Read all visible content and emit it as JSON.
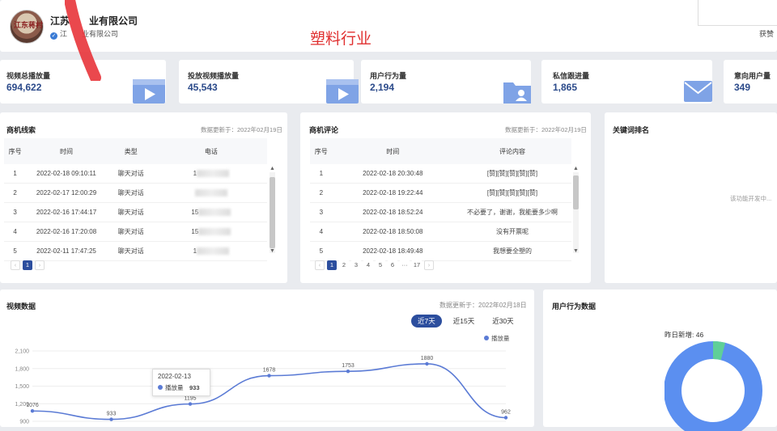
{
  "header": {
    "avatar_text": "江东蒋村",
    "company_name": "江苏　　业有限公司",
    "verified_text": "江　　业有限公司",
    "overlay_title": "塑料行业",
    "right_text": "获赞"
  },
  "stats": [
    {
      "label": "视频总播放量",
      "value": "694,622",
      "icon": "video-icon"
    },
    {
      "label": "投放视频播放量",
      "value": "45,543",
      "icon": "video-icon"
    },
    {
      "label": "用户行为量",
      "value": "2,194",
      "icon": "folder-user-icon"
    },
    {
      "label": "私信跟进量",
      "value": "1,865",
      "icon": "mail-icon"
    },
    {
      "label": "意向用户量",
      "value": "349",
      "icon": "user-icon"
    }
  ],
  "leads": {
    "title": "商机线索",
    "updated": "数据更新于：2022年02月19日",
    "columns": [
      "序号",
      "时间",
      "类型",
      "电话"
    ],
    "rows": [
      {
        "no": "1",
        "time": "2022-02-18 09:10:11",
        "type": "聊天对话",
        "phone": "1"
      },
      {
        "no": "2",
        "time": "2022-02-17 12:00:29",
        "type": "聊天对话",
        "phone": ""
      },
      {
        "no": "3",
        "time": "2022-02-16 17:44:17",
        "type": "聊天对话",
        "phone": "15"
      },
      {
        "no": "4",
        "time": "2022-02-16 17:20:08",
        "type": "聊天对话",
        "phone": "15"
      },
      {
        "no": "5",
        "time": "2022-02-11 17:47:25",
        "type": "聊天对话",
        "phone": "1"
      }
    ],
    "pages": [
      "1"
    ]
  },
  "comments": {
    "title": "商机评论",
    "updated": "数据更新于：2022年02月19日",
    "columns": [
      "序号",
      "时间",
      "评论内容"
    ],
    "rows": [
      {
        "no": "1",
        "time": "2022-02-18 20:30:48",
        "content": "[赞][赞][赞][赞][赞]"
      },
      {
        "no": "2",
        "time": "2022-02-18 19:22:44",
        "content": "[赞][赞][赞][赞][赞]"
      },
      {
        "no": "3",
        "time": "2022-02-18 18:52:24",
        "content": "不必要了，谢谢，我能要多少啊"
      },
      {
        "no": "4",
        "time": "2022-02-18 18:50:08",
        "content": "没有开票呢"
      },
      {
        "no": "5",
        "time": "2022-02-18 18:49:48",
        "content": "我想要全塑的"
      }
    ],
    "pages": [
      "1",
      "2",
      "3",
      "4",
      "5",
      "6",
      "···",
      "17"
    ]
  },
  "keywords": {
    "title": "关键词排名",
    "placeholder": "该功能开发中..."
  },
  "video": {
    "title": "视频数据",
    "updated": "数据更新于：2022年02月18日",
    "tabs": [
      "近7天",
      "近15天",
      "近30天"
    ],
    "active_tab": 0,
    "legend": "播放量",
    "tooltip": {
      "date": "2022-02-13",
      "label": "播放量",
      "value": "933"
    }
  },
  "chart_data": {
    "type": "line",
    "title": "视频数据",
    "series": [
      {
        "name": "播放量",
        "values": [
          1076,
          933,
          1195,
          1678,
          1753,
          1880,
          962
        ]
      }
    ],
    "point_labels": [
      "1076",
      "933",
      "1195",
      "1678",
      "1753",
      "1880",
      "962"
    ],
    "y_ticks": [
      "2,100",
      "1,800",
      "1,500",
      "1,200",
      "900"
    ],
    "ylim": [
      900,
      2100
    ],
    "grid": true,
    "legend_position": "top-right",
    "color": "#5b7bd5"
  },
  "behavior": {
    "title": "用户行为数据",
    "donut_label": "昨日新增: 46",
    "donut_fraction": 0.04,
    "color_main": "#5b8ff0",
    "color_accent": "#5fcf98"
  }
}
